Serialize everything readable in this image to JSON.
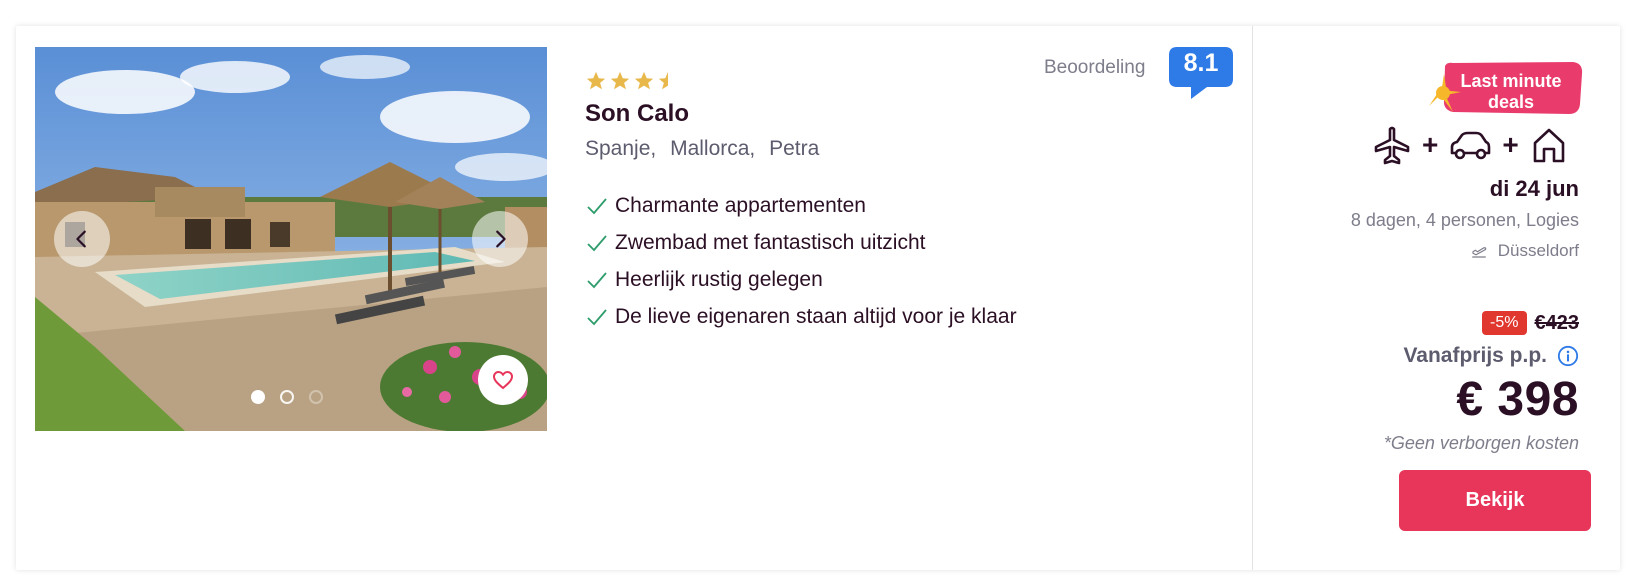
{
  "hotel": {
    "stars": 3.5,
    "name": "Son Calo",
    "location": {
      "country": "Spanje,",
      "region": "Mallorca,",
      "place": "Petra"
    },
    "usps": [
      "Charmante appartementen",
      "Zwembad met fantastisch uitzicht",
      "Heerlijk rustig gelegen",
      "De lieve eigenaren staan altijd voor je klaar"
    ]
  },
  "rating": {
    "label": "Beoordeling",
    "value": "8.1",
    "color": "#2e7be8"
  },
  "gallery": {
    "slide_count": 3,
    "active_slide": 1
  },
  "offer": {
    "deal_badge": {
      "line1": "Last minute",
      "line2": "deals",
      "color": "#e93c6c",
      "spark_color": "#f6b72b"
    },
    "transport_icons": [
      "plane-icon",
      "car-icon",
      "house-icon"
    ],
    "plus_sign": "+",
    "date": "di 24 jun",
    "details": "8 dagen, 4 personen, Logies",
    "departure": "Düsseldorf",
    "discount": "-5%",
    "old_price": "€423",
    "price_label": "Vanafprijs p.p.",
    "price": "€ 398",
    "no_hidden_costs": "*Geen verborgen kosten",
    "cta_label": "Bekijk",
    "cta_color": "#e8355a"
  },
  "colors": {
    "check": "#2e9c6b",
    "star": "#e8b84a",
    "heart": "#e8355a"
  }
}
